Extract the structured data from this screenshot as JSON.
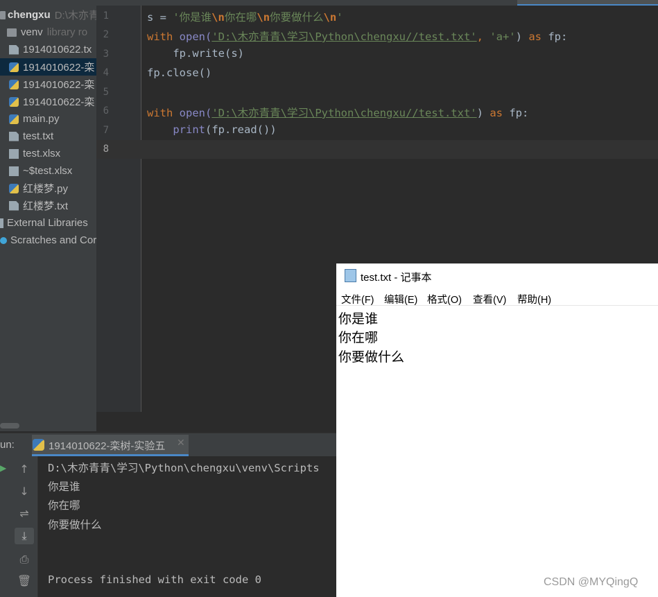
{
  "project": {
    "root": {
      "name": "chengxu",
      "path": "D:\\木亦青"
    },
    "items": [
      {
        "label": "venv",
        "hint": "library ro",
        "icon": "folder-icon"
      },
      {
        "label": "1914010622.tx",
        "icon": "text-file-icon"
      },
      {
        "label": "1914010622-栾",
        "icon": "python-file-icon"
      },
      {
        "label": "1914010622-栾",
        "icon": "python-file-icon"
      },
      {
        "label": "1914010622-栾",
        "icon": "python-file-icon"
      },
      {
        "label": "main.py",
        "icon": "python-file-icon"
      },
      {
        "label": "test.txt",
        "icon": "text-file-icon"
      },
      {
        "label": "test.xlsx",
        "icon": "unknown-file-icon"
      },
      {
        "label": "~$test.xlsx",
        "icon": "unknown-file-icon"
      },
      {
        "label": "红楼梦.py",
        "icon": "python-file-icon"
      },
      {
        "label": "红楼梦.txt",
        "icon": "text-file-icon"
      },
      {
        "label": "External Libraries",
        "icon": "library-icon"
      },
      {
        "label": "Scratches and Cor",
        "icon": "scratch-icon"
      }
    ]
  },
  "editor": {
    "line_numbers": [
      "1",
      "2",
      "3",
      "4",
      "5",
      "6",
      "7",
      "8"
    ],
    "code": {
      "l1_a": "s = ",
      "l1_b": "'你是谁",
      "l1_c": "\\n",
      "l1_d": "你在哪",
      "l1_e": "\\n",
      "l1_f": "你要做什么",
      "l1_g": "\\n",
      "l1_h": "'",
      "l2_with": "with ",
      "l2_open": "open(",
      "l2_path": "'D:\\木亦青青\\学习\\Python\\chengxu//test.txt'",
      "l2_mid": ", ",
      "l2_mode": "'a+'",
      "l2_close": ") ",
      "l2_as": "as",
      "l2_fp": " fp:",
      "l3": "    fp.write(s)",
      "l4": "fp.close()",
      "l6_with": "with ",
      "l6_open": "open(",
      "l6_path": "'D:\\木亦青青\\学习\\Python\\chengxu//test.txt'",
      "l6_close": ") ",
      "l6_as": "as",
      "l6_fp": " fp:",
      "l7_indent": "    ",
      "l7_print": "print",
      "l7_rest": "(fp.read())"
    }
  },
  "run": {
    "label": "un:",
    "tab_label": "1914010622-栾树-实验五",
    "console": [
      "D:\\木亦青青\\学习\\Python\\chengxu\\venv\\Scripts",
      "你是谁",
      "你在哪",
      "你要做什么",
      "Process finished with exit code 0"
    ]
  },
  "notepad": {
    "title": "test.txt - 记事本",
    "menu": [
      "文件(F)",
      "编辑(E)",
      "格式(O)",
      "查看(V)",
      "帮助(H)"
    ],
    "lines": [
      "你是谁",
      "你在哪",
      "你要做什么"
    ]
  },
  "watermark": "CSDN @MYQingQ",
  "colors": {
    "keyword": "#cc7832",
    "string": "#6a8759",
    "builtin": "#8888c6",
    "selection": "#0d293e",
    "accent": "#4a88c7"
  }
}
